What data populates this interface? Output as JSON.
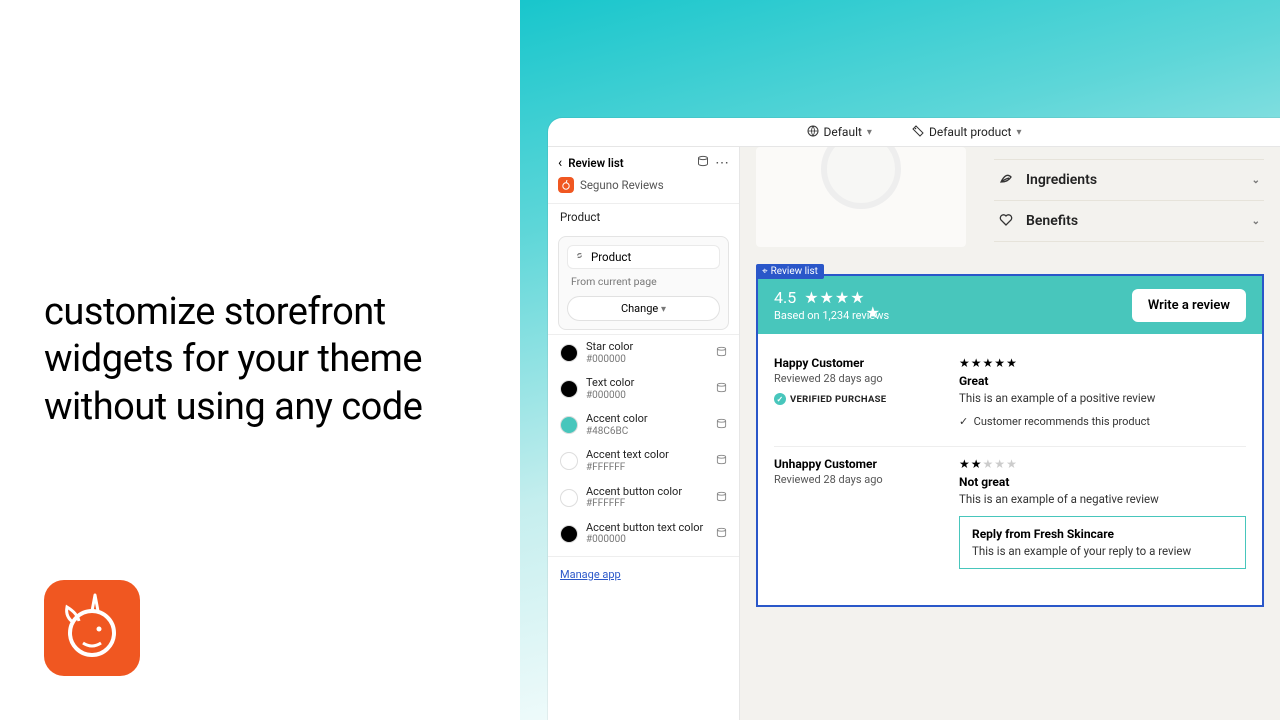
{
  "headline": "customize storefront widgets for your theme without using any code",
  "topbar": {
    "view": "Default",
    "product": "Default product"
  },
  "sidebar": {
    "title": "Review list",
    "app_name": "Seguno Reviews",
    "section_label": "Product",
    "product_field": "Product",
    "from_text": "From current page",
    "change_label": "Change",
    "manage_label": "Manage app",
    "colors": [
      {
        "name": "Star color",
        "hex": "#000000",
        "sw": "#000000"
      },
      {
        "name": "Text color",
        "hex": "#000000",
        "sw": "#000000"
      },
      {
        "name": "Accent color",
        "hex": "#48C6BC",
        "sw": "#48C6BC"
      },
      {
        "name": "Accent text color",
        "hex": "#FFFFFF",
        "sw": "#FFFFFF"
      },
      {
        "name": "Accent button color",
        "hex": "#FFFFFF",
        "sw": "#FFFFFF"
      },
      {
        "name": "Accent button text color",
        "hex": "#000000",
        "sw": "#000000"
      }
    ]
  },
  "preview": {
    "accordion": [
      {
        "label": "Ingredients"
      },
      {
        "label": "Benefits"
      }
    ],
    "widget_tag": "Review list",
    "score": "4.5",
    "based": "Based on 1,234 reviews",
    "write_label": "Write a review",
    "reviews": [
      {
        "name": "Happy Customer",
        "date": "Reviewed 28 days ago",
        "badge": "VERIFIED PURCHASE",
        "stars": 5,
        "title": "Great",
        "text": "This is an example of a positive review",
        "rec": "Customer recommends this product"
      },
      {
        "name": "Unhappy Customer",
        "date": "Reviewed 28 days ago",
        "stars": 2,
        "title": "Not great",
        "text": "This is an example of a negative review",
        "reply_from": "Reply from Fresh Skincare",
        "reply_text": "This is an example of your reply to a review"
      }
    ]
  }
}
